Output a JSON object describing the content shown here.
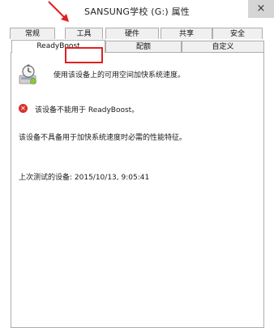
{
  "window": {
    "title": "SANSUNG学校 (G:) 属性",
    "close_glyph": "×"
  },
  "tabs": {
    "row1": [
      "常规",
      "工具",
      "硬件",
      "共享",
      "安全"
    ],
    "row2": [
      "ReadyBoost",
      "配额",
      "自定义"
    ]
  },
  "readyboost": {
    "info": "使用该设备上的可用空间加快系统速度。",
    "error_title": "该设备不能用于 ReadyBoost。",
    "detail": "该设备不具备用于加快系统速度时必需的性能特征。",
    "last_test": "上次测试的设备: 2015/10/13, 9:05:41"
  },
  "colors": {
    "highlight": "#e02020",
    "error": "#d9302b"
  },
  "icons": {
    "readyboost": "stopwatch-icon",
    "error": "error-x-icon",
    "annotation": "red-arrow-icon"
  }
}
